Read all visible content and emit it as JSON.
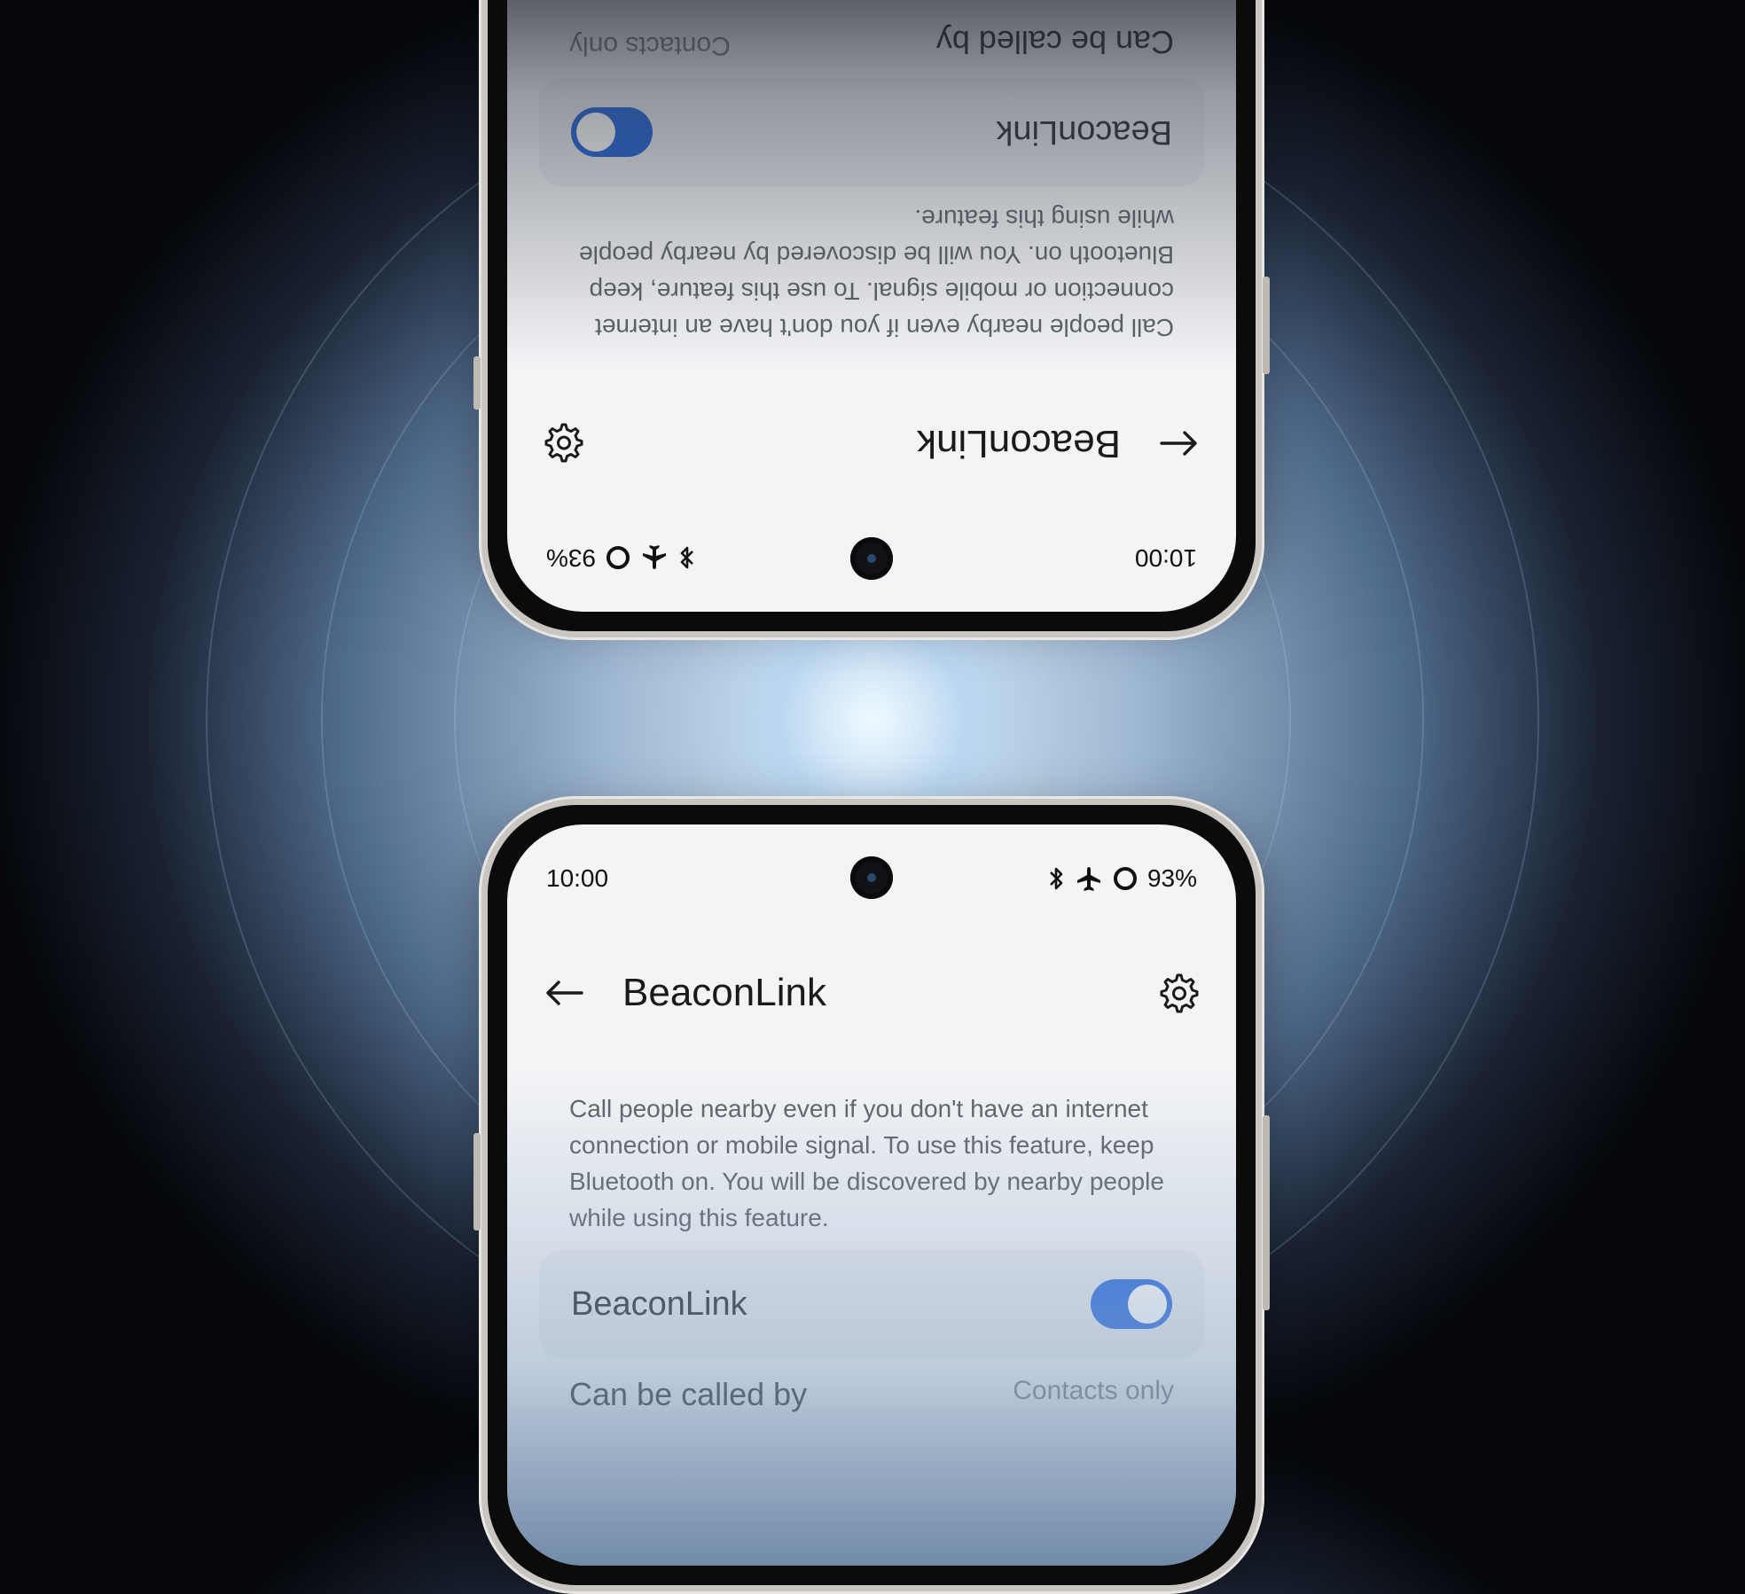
{
  "status": {
    "time": "10:00",
    "battery": "93%",
    "icons": [
      "bluetooth-icon",
      "airplane-icon",
      "battery-ring-icon"
    ]
  },
  "header": {
    "title": "BeaconLink",
    "back_icon": "arrow-left-icon",
    "settings_icon": "gear-icon"
  },
  "description": "Call people nearby even if you don't have an internet connection or mobile signal. To use this feature, keep Bluetooth on. You will be discovered by nearby people while using this feature.",
  "toggle_card": {
    "label": "BeaconLink",
    "enabled": true
  },
  "call_setting": {
    "label": "Can be called by",
    "value": "Contacts only"
  },
  "colors": {
    "accent": "#2f6fe0",
    "screen_bg": "#f3f4f6",
    "card_bg": "#e9ebee",
    "text_secondary": "#5f6368"
  }
}
